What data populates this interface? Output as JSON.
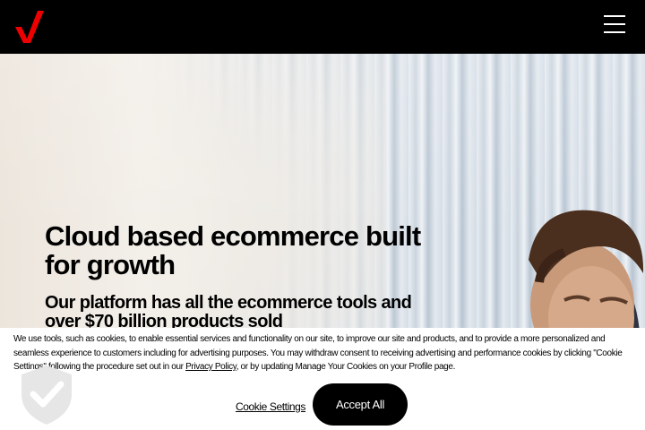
{
  "header": {
    "logo_icon": "verizon-check-logo-icon",
    "menu_icon": "hamburger-menu-icon",
    "brand_color": "#ee0000"
  },
  "hero": {
    "headline": "Cloud based ecommerce built for growth",
    "subheadline": "Our platform has all the ecommerce tools and over $70 billion products sold"
  },
  "cookie_banner": {
    "text_before_link": "We use tools, such as cookies, to enable essential services and functionality on our site, to improve our site and products, and to provide a more personalized and seamless experience to customers including for advertising purposes. You may withdraw consent to receiving advertising and performance cookies by clicking \"Cookie Settings\" following the procedure set out in our ",
    "privacy_link": "Privacy Policy",
    "text_after_link": ", or by updating Manage Your Cookies on your Profile page.",
    "settings_label": "Cookie Settings",
    "accept_label": "Accept All",
    "shield_icon": "shield-check-icon"
  }
}
